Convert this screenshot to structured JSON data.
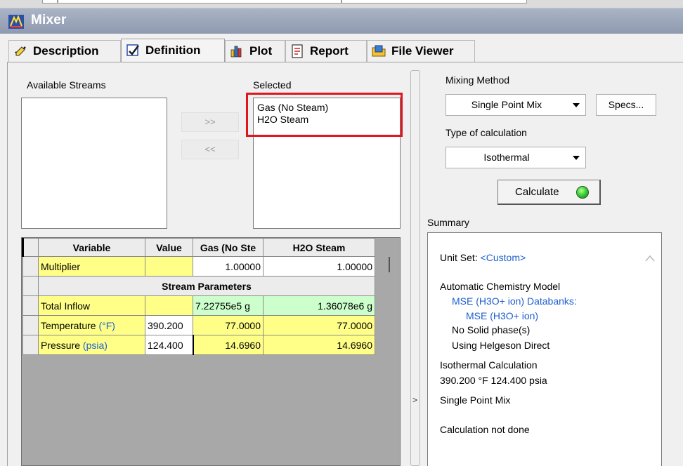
{
  "window": {
    "title": "Mixer"
  },
  "tabs": [
    {
      "label": "Description",
      "icon": "pencil-check-icon"
    },
    {
      "label": "Definition",
      "icon": "definition-icon"
    },
    {
      "label": "Plot",
      "icon": "bar-chart-icon"
    },
    {
      "label": "Report",
      "icon": "report-icon"
    },
    {
      "label": "File Viewer",
      "icon": "file-viewer-icon"
    }
  ],
  "streams": {
    "available_label": "Available Streams",
    "selected_label": "Selected",
    "selected_items": [
      "Gas (No Steam)",
      "H2O Steam"
    ],
    "add_label": ">>",
    "remove_label": "<<"
  },
  "grid": {
    "headers": [
      "Variable",
      "Value",
      "Gas (No Ste",
      "H2O Steam"
    ],
    "multiplier": {
      "label": "Multiplier",
      "value": "",
      "gas": "1.00000",
      "h2o": "1.00000"
    },
    "section_label": "Stream Parameters",
    "total_inflow": {
      "label": "Total Inflow",
      "value": "",
      "gas": "7.22755e5 g",
      "h2o": "1.36078e6 g"
    },
    "temperature": {
      "label": "Temperature",
      "unit": "(°F)",
      "value": "390.200",
      "gas": "77.0000",
      "h2o": "77.0000"
    },
    "pressure": {
      "label": "Pressure",
      "unit": "(psia)",
      "value": "124.400",
      "gas": "14.6960",
      "h2o": "14.6960"
    }
  },
  "right": {
    "mixing_method_label": "Mixing Method",
    "mixing_method_value": "Single Point Mix",
    "specs_label": "Specs...",
    "calc_type_label": "Type of calculation",
    "calc_type_value": "Isothermal",
    "calculate_label": "Calculate",
    "status_color": "#3bd23b"
  },
  "summary": {
    "label": "Summary",
    "unit_set_label": "Unit Set:",
    "unit_set_value": "<Custom>",
    "model_label": "Automatic Chemistry Model",
    "databanks_line": "MSE (H3O+ ion) Databanks:",
    "databank_value": "MSE (H3O+ ion)",
    "solid_line": "No Solid phase(s)",
    "helgeson_line": "Using Helgeson Direct",
    "calc_line1": "Isothermal Calculation",
    "calc_line2": "390.200 °F 124.400 psia",
    "mix_line": "Single Point Mix",
    "status_line": "Calculation not done"
  }
}
